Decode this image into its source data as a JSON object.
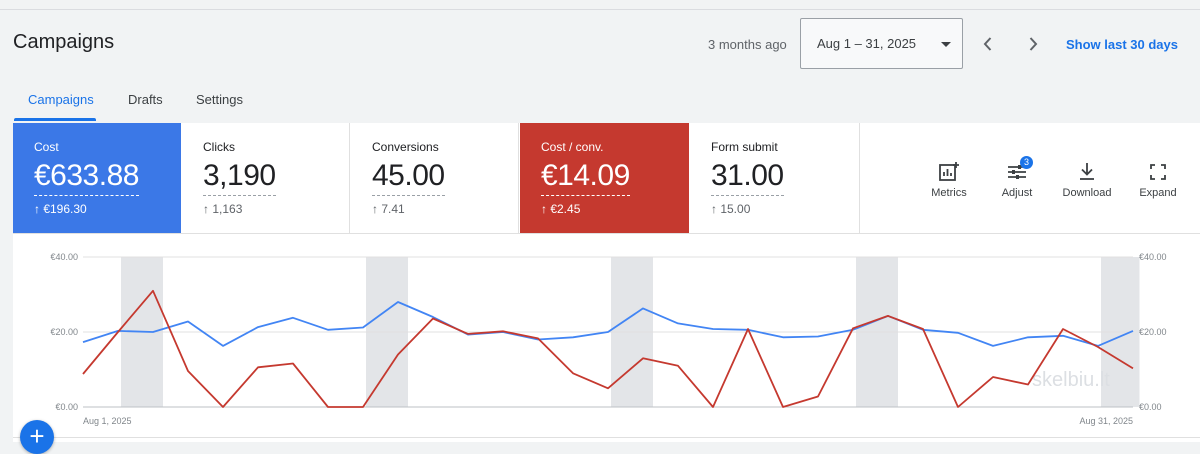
{
  "header": {
    "title": "Campaigns",
    "relative_time": "3 months ago",
    "date_range": "Aug 1 – 31, 2025",
    "show_last": "Show last 30 days"
  },
  "tabs": [
    {
      "label": "Campaigns",
      "active": true
    },
    {
      "label": "Drafts",
      "active": false
    },
    {
      "label": "Settings",
      "active": false
    }
  ],
  "scorecards": [
    {
      "label": "Cost",
      "value": "€633.88",
      "delta": "↑ €196.30",
      "style": "blue",
      "color": "#3b78e7"
    },
    {
      "label": "Clicks",
      "value": "3,190",
      "delta": "↑ 1,163",
      "style": "white"
    },
    {
      "label": "Conversions",
      "value": "45.00",
      "delta": "↑ 7.41",
      "style": "white"
    },
    {
      "label": "Cost / conv.",
      "value": "€14.09",
      "delta": "↑ €2.45",
      "style": "red",
      "color": "#c5392f"
    },
    {
      "label": "Form submit",
      "value": "31.00",
      "delta": "↑ 15.00",
      "style": "white"
    }
  ],
  "tools": [
    {
      "label": "Metrics",
      "icon": "metrics-icon"
    },
    {
      "label": "Adjust",
      "icon": "adjust-icon",
      "badge": "3"
    },
    {
      "label": "Download",
      "icon": "download-icon"
    },
    {
      "label": "Expand",
      "icon": "expand-icon"
    }
  ],
  "watermark": "skelbiu.lt",
  "chart_data": {
    "type": "line",
    "x_start_label": "Aug 1, 2025",
    "x_end_label": "Aug 31, 2025",
    "y_left_ticks": [
      "€40.00",
      "€20.00",
      "€0.00"
    ],
    "y_right_ticks": [
      "€40.00",
      "€20.00",
      "€0.00"
    ],
    "ylim": [
      0,
      40
    ],
    "weekend_bands": [
      [
        2,
        3
      ],
      [
        9,
        10
      ],
      [
        16,
        17
      ],
      [
        23,
        24
      ],
      [
        30,
        31
      ]
    ],
    "grid": true,
    "series": [
      {
        "color": "#4285f4",
        "values": [
          17.3,
          20.3,
          20.0,
          22.8,
          16.3,
          21.3,
          23.8,
          20.6,
          21.2,
          28.0,
          24.0,
          19.3,
          20.0,
          18.0,
          18.6,
          20.0,
          26.3,
          22.3,
          20.8,
          20.6,
          18.6,
          18.8,
          20.6,
          24.3,
          20.6,
          19.8,
          16.3,
          18.6,
          19.0,
          16.3,
          20.3
        ]
      },
      {
        "color": "#c5392f",
        "values": [
          8.8,
          20.0,
          31.0,
          9.6,
          0.0,
          10.6,
          11.6,
          0.0,
          0.0,
          14.0,
          23.6,
          19.5,
          20.2,
          18.3,
          9.0,
          5.0,
          13.0,
          11.0,
          0.0,
          20.8,
          0.0,
          2.8,
          21.0,
          24.3,
          20.8,
          0.0,
          8.0,
          6.0,
          20.8,
          16.0,
          10.3
        ]
      }
    ]
  }
}
